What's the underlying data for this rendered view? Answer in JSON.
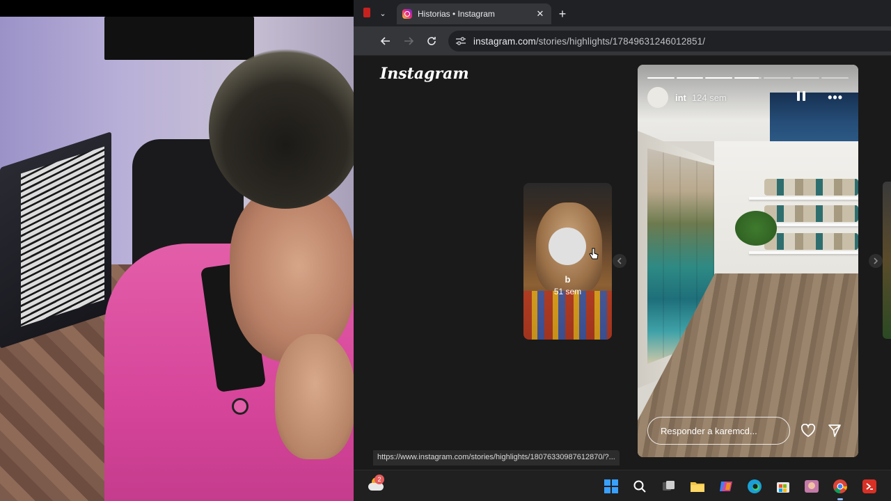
{
  "browser": {
    "tab": {
      "title": "Historias • Instagram",
      "close_glyph": "✕"
    },
    "new_tab_glyph": "+",
    "tab_menu_glyph": "⌄",
    "url": {
      "host": "instagram.com",
      "path": "/stories/highlights/17849631246012851/"
    }
  },
  "instagram": {
    "logo_text": "Instagram",
    "preview": {
      "name": "b",
      "time": "51 sem"
    },
    "story": {
      "username": "int",
      "time": "124 sem",
      "progress_segments": [
        1,
        1,
        1,
        0.9,
        0,
        0,
        0
      ],
      "reply_placeholder": "Responder a karemcd..."
    },
    "status_url": "https://www.instagram.com/stories/highlights/18076330987612870/?..."
  },
  "taskbar": {
    "weather_badge": "2",
    "icons": [
      "windows-start-icon",
      "search-icon",
      "task-view-icon",
      "file-explorer-icon",
      "copilot-icon",
      "edge-icon",
      "store-icon",
      "photos-icon",
      "chrome-icon",
      "app-icon"
    ]
  },
  "colors": {
    "accent": "#8ab4f8",
    "tab_bg": "#35363a",
    "viewport_bg": "#1a1a1a"
  }
}
